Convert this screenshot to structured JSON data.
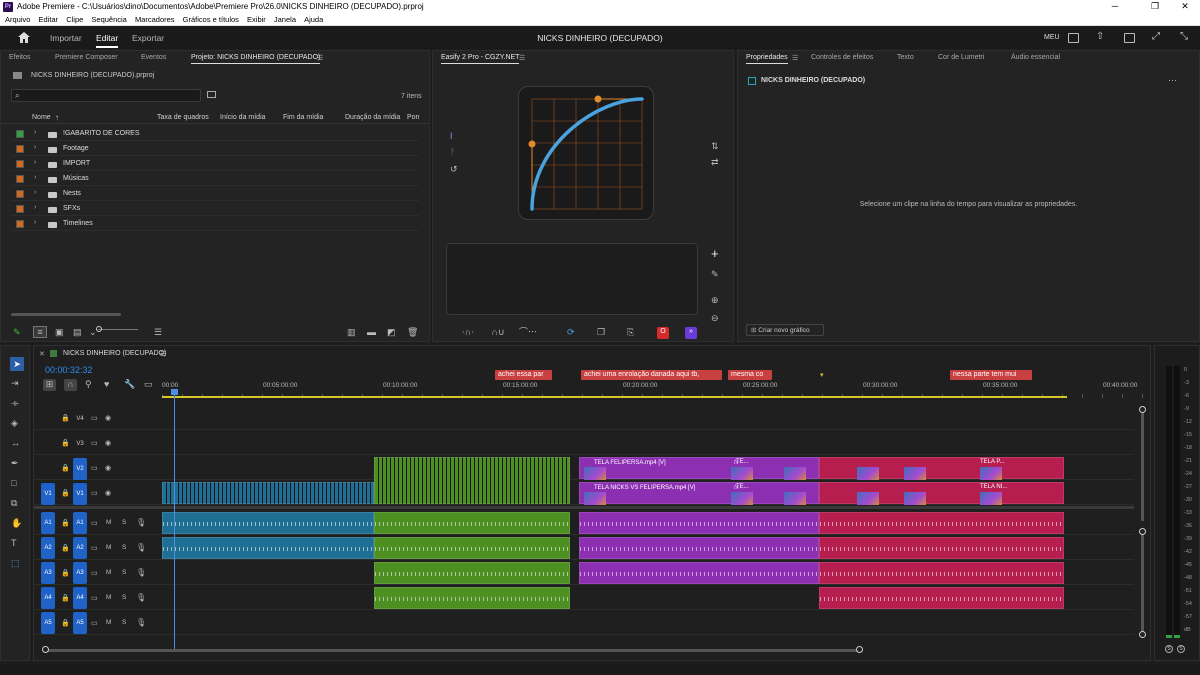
{
  "window": {
    "title": "Adobe Premiere - C:\\Usuários\\dino\\Documentos\\Adobe\\Premiere Pro\\26.0\\NICKS DINHEIRO (DECUPADO).prproj",
    "app_icon": "Pr"
  },
  "menu": [
    "Arquivo",
    "Editar",
    "Clipe",
    "Sequência",
    "Marcadores",
    "Gráficos e títulos",
    "Exibir",
    "Janela",
    "Ajuda"
  ],
  "header": {
    "workspaces": [
      "Importar",
      "Editar",
      "Exportar"
    ],
    "active_workspace": "Editar",
    "project_title": "NICKS DINHEIRO (DECUPADO)",
    "meu": "MEU"
  },
  "project_panel": {
    "tabs": [
      "Efeitos",
      "Premiere Composer",
      "Eventos",
      "Projeto: NICKS DINHEIRO (DECUPADO)"
    ],
    "active_tab": "Projeto: NICKS DINHEIRO (DECUPADO)",
    "file": "NICKS DINHEIRO (DECUPADO).prproj",
    "item_count": "7 itens",
    "search_placeholder": "",
    "columns": [
      "Nome",
      "Taxa de quadros",
      "Início da mídia",
      "Fim da mídia",
      "Duração da mídia",
      "Pon"
    ],
    "items": [
      {
        "name": "!GABARITO DE CORES",
        "color": "#2fa344"
      },
      {
        "name": "Footage",
        "color": "#d2691e"
      },
      {
        "name": "IMPORT",
        "color": "#d2691e"
      },
      {
        "name": "Músicas",
        "color": "#d2691e"
      },
      {
        "name": "Nests",
        "color": "#d2691e"
      },
      {
        "name": "SFXs",
        "color": "#d2691e"
      },
      {
        "name": "Timelines",
        "color": "#d2691e"
      }
    ]
  },
  "easify_panel": {
    "tab": "Easify 2 Pro - CGZY.NET"
  },
  "properties_panel": {
    "tabs": [
      "Propriedades",
      "Controles de efeitos",
      "Texto",
      "Cor de Lumetri",
      "Áudio essencial"
    ],
    "active_tab": "Propriedades",
    "sequence": "NICKS DINHEIRO (DECUPADO)",
    "empty_message": "Selecione um clipe na linha do tempo para visualizar as propriedades.",
    "create_graphic": "Criar novo gráfico"
  },
  "timeline": {
    "sequence_name": "NICKS DINHEIRO (DECUPADO)",
    "timecode": "00:00:32:32",
    "ruler": [
      "00:00",
      "00:05:00:00",
      "00:10:00:00",
      "00:15:00:00",
      "00:20:00:00",
      "00:25:00:00",
      "00:30:00:00",
      "00:35:00:00",
      "00:40:00:00"
    ],
    "markers": [
      "achei essa par",
      "achei uma enrolação danada aqui tb,",
      "mesma co",
      "nessa parte tem mui"
    ],
    "video_tracks": [
      "V4",
      "V3",
      "V2",
      "V1"
    ],
    "audio_tracks": [
      "A1",
      "A2",
      "A3",
      "A4",
      "A5"
    ],
    "source_patch_video": "V1",
    "audio_mute": "M",
    "audio_solo": "S",
    "clips": {
      "v2_purple_1": "TELA FELIPERSA.mp4 [V]",
      "v2_purple_2": "TE...",
      "v2_red": "TELA P...",
      "v1_purple_1": "TELA NICKS VS FELIPERSA.mp4 [V]",
      "v1_purple_2": "TE...",
      "v1_red": "TELA NI...",
      "fx": "fx"
    }
  },
  "audio_meter": {
    "scale": [
      "0",
      "-3",
      "-6",
      "-9",
      "-12",
      "-15",
      "-18",
      "-21",
      "-24",
      "-27",
      "-30",
      "-33",
      "-36",
      "-39",
      "-42",
      "-45",
      "-48",
      "-51",
      "-54",
      "-57",
      "dB"
    ],
    "solo": "S"
  },
  "colors": {
    "accent": "#2d8ceb",
    "clip_blue": "#1f6e93",
    "clip_green": "#4e8f22",
    "clip_purple": "#8d2fb3",
    "clip_red": "#b51e4f",
    "marker": "#d14a4a",
    "easify_curve": "#4aa3df",
    "easify_handle": "#e38a2a"
  }
}
